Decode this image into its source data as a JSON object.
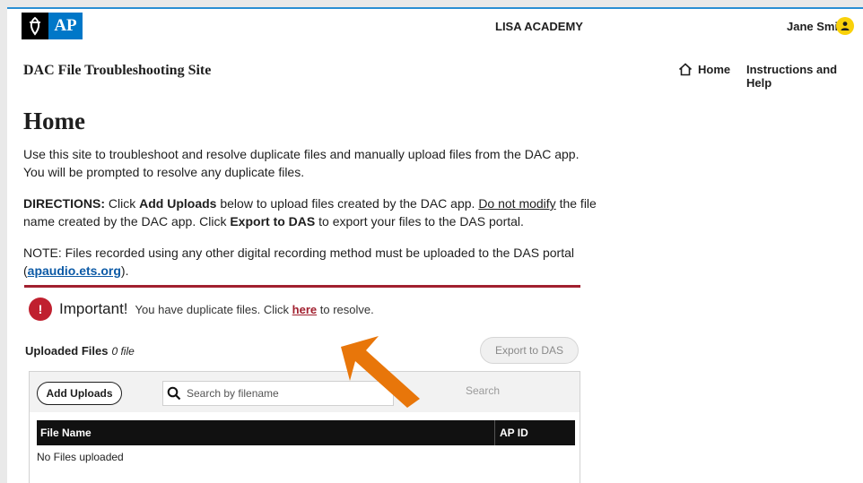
{
  "header": {
    "logo_text": "AP",
    "org_name": "LISA ACADEMY",
    "user_name": "Jane Smith"
  },
  "subheader": {
    "site_title": "DAC File Troubleshooting Site",
    "nav_home": "Home",
    "nav_help": "Instructions and Help"
  },
  "main": {
    "page_title": "Home",
    "intro": "Use this site to troubleshoot and resolve duplicate files and manually upload files from the DAC app. You will be prompted to resolve any duplicate files.",
    "directions": {
      "label": "DIRECTIONS:",
      "t1": " Click ",
      "b1": "Add Uploads",
      "t2": " below to upload files created by the DAC app. ",
      "u1": "Do not modify",
      "t3": " the file name created by the DAC app. Click ",
      "b2": "Export to DAS",
      "t4": " to export your files to the DAS portal."
    },
    "note": {
      "text": "NOTE: Files recorded using any other digital recording method must be uploaded to the DAS portal (",
      "link": "apaudio.ets.org",
      "after": ")."
    },
    "important": {
      "icon_glyph": "!",
      "heading": "Important!",
      "text_before": "You have duplicate files. Click ",
      "link": "here",
      "text_after": " to resolve."
    },
    "uploaded": {
      "title": "Uploaded Files",
      "count": "0 file",
      "export_label": "Export to DAS"
    },
    "toolbar": {
      "add_label": "Add Uploads",
      "search_placeholder": "Search by filename",
      "search_label": "Search"
    },
    "table": {
      "columns": [
        "File Name",
        "AP ID"
      ],
      "empty": "No Files uploaded"
    }
  },
  "colors": {
    "accent_blue": "#0077c8",
    "rule_red": "#a1202f",
    "arrow_orange": "#e8760a",
    "avatar_yellow": "#f9d10a"
  }
}
